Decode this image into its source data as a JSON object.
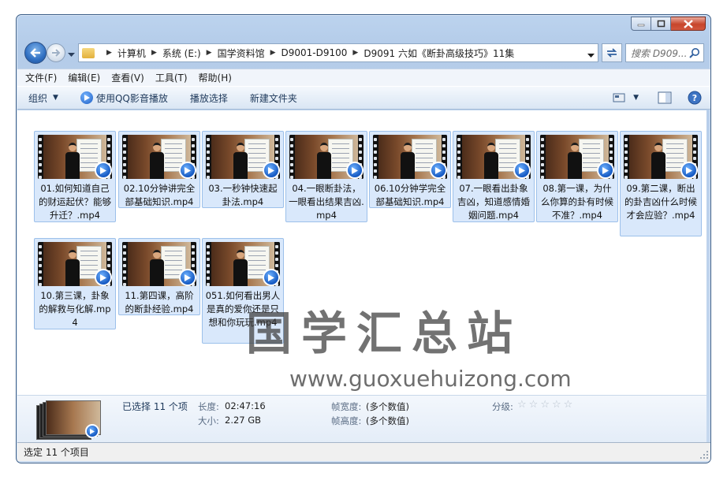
{
  "window": {
    "caption_buttons": [
      "minimize",
      "maximize",
      "close"
    ]
  },
  "address": {
    "crumbs": [
      "计算机",
      "系统 (E:)",
      "国学资料馆",
      "D9001-D9100",
      "D9091 六如《断卦高级技巧》11集"
    ],
    "search_placeholder": "搜索 D909..."
  },
  "menu": {
    "items": [
      "文件(F)",
      "编辑(E)",
      "查看(V)",
      "工具(T)",
      "帮助(H)"
    ]
  },
  "toolbar": {
    "organize": "组织",
    "play_qq": "使用QQ影音播放",
    "play_selection": "播放选择",
    "new_folder": "新建文件夹"
  },
  "files": [
    {
      "name": "01.如何知道自己的财运起伏？能够升迁？.mp4"
    },
    {
      "name": "02.10分钟讲完全部基础知识.mp4"
    },
    {
      "name": "03.一秒钟快速起卦法.mp4"
    },
    {
      "name": "04.一眼断卦法，一眼看出结果吉凶.mp4"
    },
    {
      "name": "06.10分钟学完全部基础知识.mp4"
    },
    {
      "name": "07.一眼看出卦象吉凶，知道感情婚姻问题.mp4"
    },
    {
      "name": "08.第一课，为什么你算的卦有时候不准？.mp4"
    },
    {
      "name": "09.第二课，断出的卦吉凶什么时候才会应验？.mp4"
    },
    {
      "name": "10.第三课，卦象的解救与化解.mp4"
    },
    {
      "name": "11.第四课，高阶的断卦经验.mp4"
    },
    {
      "name": "051.如何看出男人是真的爱你还是只想和你玩玩.mp4"
    }
  ],
  "watermark": {
    "title": "国学汇总站",
    "url": "www.guoxuehuizong.com"
  },
  "details": {
    "selected": "已选择 11 个项",
    "length_label": "长度:",
    "length_value": "02:47:16",
    "size_label": "大小:",
    "size_value": "2.27 GB",
    "frame_width_label": "帧宽度:",
    "frame_width_value": "(多个数值)",
    "frame_height_label": "帧高度:",
    "frame_height_value": "(多个数值)",
    "rating_label": "分级:",
    "rating_value": 0,
    "rating_max": 5
  },
  "status": {
    "text": "选定 11 个项目"
  },
  "colors": {
    "selection_fill": "#d9e8fb",
    "selection_border": "#9cc0ea",
    "accent_blue": "#1559c2"
  }
}
